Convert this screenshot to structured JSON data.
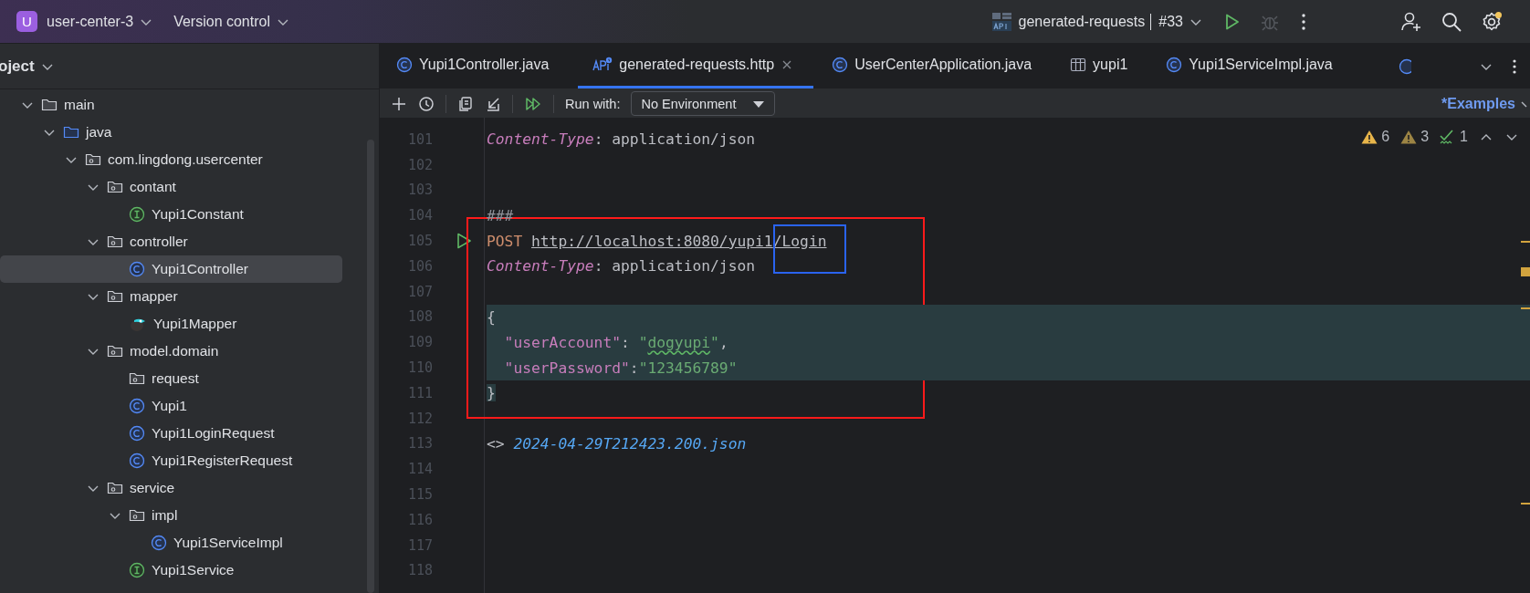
{
  "title_bar": {
    "project_badge": "U",
    "project": "user-center-3",
    "vcs": "Version control",
    "run_config": "generated-requests",
    "run_number": "#33",
    "debug_disabled": true,
    "settings_notification": true
  },
  "project_panel": {
    "title": "oject",
    "tree": [
      {
        "label": "main",
        "kind": "folder",
        "expanded": true,
        "selected": false,
        "children": [
          {
            "label": "java",
            "kind": "source",
            "expanded": true,
            "selected": false,
            "children": [
              {
                "label": "com.lingdong.usercenter",
                "kind": "package",
                "expanded": true,
                "selected": false,
                "children": [
                  {
                    "label": "contant",
                    "kind": "package",
                    "expanded": true,
                    "selected": false,
                    "children": [
                      {
                        "label": "Yupi1Constant",
                        "kind": "interface",
                        "selected": false
                      }
                    ]
                  },
                  {
                    "label": "controller",
                    "kind": "package",
                    "expanded": true,
                    "selected": false,
                    "children": [
                      {
                        "label": "Yupi1Controller",
                        "kind": "class",
                        "selected": true
                      }
                    ]
                  },
                  {
                    "label": "mapper",
                    "kind": "package",
                    "expanded": true,
                    "selected": false,
                    "children": [
                      {
                        "label": "Yupi1Mapper",
                        "kind": "mapper",
                        "selected": false
                      }
                    ]
                  },
                  {
                    "label": "model.domain",
                    "kind": "package",
                    "expanded": true,
                    "selected": false,
                    "children": [
                      {
                        "label": "request",
                        "kind": "package",
                        "selected": false
                      },
                      {
                        "label": "Yupi1",
                        "kind": "class",
                        "selected": false
                      },
                      {
                        "label": "Yupi1LoginRequest",
                        "kind": "class",
                        "selected": false
                      },
                      {
                        "label": "Yupi1RegisterRequest",
                        "kind": "class",
                        "selected": false
                      }
                    ]
                  },
                  {
                    "label": "service",
                    "kind": "package",
                    "expanded": true,
                    "selected": false,
                    "children": [
                      {
                        "label": "impl",
                        "kind": "package",
                        "expanded": true,
                        "selected": false,
                        "children": [
                          {
                            "label": "Yupi1ServiceImpl",
                            "kind": "class",
                            "selected": false
                          }
                        ]
                      },
                      {
                        "label": "Yupi1Service",
                        "kind": "interface",
                        "selected": false
                      }
                    ]
                  }
                ]
              }
            ]
          }
        ]
      }
    ]
  },
  "tabs": [
    {
      "label": "Yupi1Controller.java",
      "kind": "class",
      "selected": false
    },
    {
      "label": "generated-requests.http",
      "kind": "http",
      "selected": true
    },
    {
      "label": "UserCenterApplication.java",
      "kind": "class",
      "selected": false
    },
    {
      "label": "yupi1",
      "kind": "table",
      "selected": false
    },
    {
      "label": "Yupi1ServiceImpl.java",
      "kind": "class",
      "selected": false
    }
  ],
  "toolbar": {
    "run_with_label": "Run with:",
    "environment": "No Environment",
    "examples": "*Examples"
  },
  "inspections": [
    {
      "kind": "warning",
      "count": "6"
    },
    {
      "kind": "weak-warning",
      "count": "3"
    },
    {
      "kind": "typo",
      "count": "1"
    }
  ],
  "editor": {
    "blocks": [
      {
        "lines": [
          {
            "number": "101",
            "tokens": [
              {
                "kind": "header",
                "text": "Content-Type"
              },
              {
                "kind": "plain",
                "text": ": application/json"
              }
            ]
          },
          {
            "number": "102"
          },
          {
            "number": "103"
          }
        ]
      },
      {
        "framed": true,
        "lines": [
          {
            "number": "104",
            "tokens": [
              {
                "kind": "comment",
                "text": "###"
              }
            ]
          },
          {
            "number": "105",
            "runnable": true,
            "tokens": [
              {
                "kind": "method",
                "text": "POST "
              },
              {
                "kind": "url",
                "text": "http://localhost:8080/yupi1"
              },
              {
                "kind": "url",
                "text": "/Login",
                "framed": true
              }
            ]
          },
          {
            "number": "106",
            "tokens": [
              {
                "kind": "header",
                "text": "Content-Type"
              },
              {
                "kind": "plain",
                "text": ": application/json"
              }
            ]
          },
          {
            "number": "107"
          },
          {
            "number": "108",
            "highlighted": true,
            "tokens": [
              {
                "kind": "plain",
                "text": "{"
              }
            ]
          },
          {
            "number": "109",
            "highlighted": true,
            "indented": true,
            "tokens": [
              {
                "kind": "key",
                "text": "\"userAccount\""
              },
              {
                "kind": "plain",
                "text": ": "
              },
              {
                "kind": "string",
                "text": "\""
              },
              {
                "kind": "string",
                "text": "dogyupi",
                "typo": true
              },
              {
                "kind": "string",
                "text": "\""
              },
              {
                "kind": "plain",
                "text": ","
              }
            ]
          },
          {
            "number": "110",
            "highlighted": true,
            "indented": true,
            "tokens": [
              {
                "kind": "key",
                "text": "\"userPassword\""
              },
              {
                "kind": "plain",
                "text": ":"
              },
              {
                "kind": "string",
                "text": "\"123456789\""
              }
            ]
          },
          {
            "number": "111",
            "tokens": [
              {
                "kind": "plain",
                "text": "}",
                "highlighted": true
              }
            ]
          }
        ]
      },
      {
        "lines": [
          {
            "number": "112"
          },
          {
            "number": "113",
            "tokens": [
              {
                "kind": "plain",
                "text": "<> "
              },
              {
                "kind": "file",
                "text": "2024-04-29T212423.200.json"
              }
            ]
          },
          {
            "number": "114"
          },
          {
            "number": "115"
          },
          {
            "number": "116"
          },
          {
            "number": "117"
          },
          {
            "number": "118"
          }
        ]
      }
    ]
  }
}
